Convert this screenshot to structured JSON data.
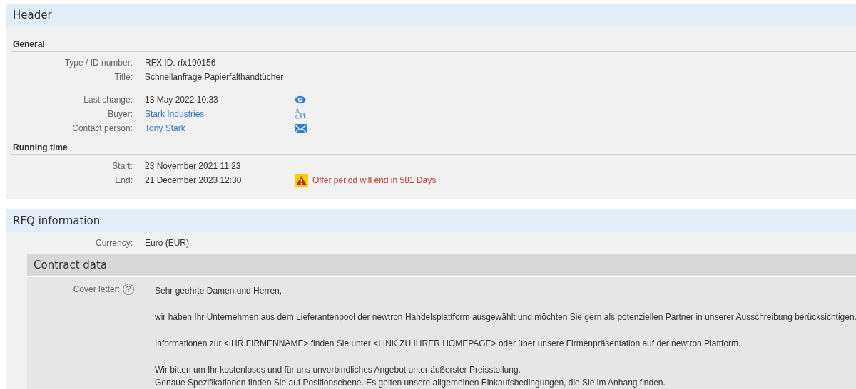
{
  "header": {
    "title": "Header",
    "sections": [
      {
        "title": "General",
        "groups": [
          [
            {
              "label": "Type / ID number:",
              "value": "RFX ID: rfx190156",
              "kind": "text"
            },
            {
              "label": "Title:",
              "value": "Schnellanfrage Papierfalthandtücher",
              "kind": "text"
            }
          ],
          [
            {
              "label": "Last change:",
              "value": "13 May 2022 10:33",
              "kind": "text",
              "action": {
                "kind": "view"
              }
            },
            {
              "label": "Buyer:",
              "value": "Stark Industries",
              "kind": "link",
              "action": {
                "kind": "letters",
                "glyphs": [
                  "A",
                  "C",
                  "B"
                ]
              }
            },
            {
              "label": "Contact person:",
              "value": "Tony Stark",
              "kind": "link",
              "action": {
                "kind": "mail"
              }
            }
          ]
        ]
      },
      {
        "title": "Running time",
        "groups": [
          [
            {
              "label": "Start:",
              "value": "23 November 2021 11:23",
              "kind": "text"
            },
            {
              "label": "End:",
              "value": "21 December 2023 12:30",
              "kind": "text",
              "warning": "Offer period will end in 581 Days"
            }
          ]
        ]
      }
    ]
  },
  "rfq": {
    "title": "RFQ information",
    "currency": {
      "label": "Currency:",
      "value": "Euro (EUR)"
    },
    "contract": {
      "title": "Contract data",
      "cover_label": "Cover letter:",
      "help": "?",
      "paragraphs": [
        [
          "Sehr geehrte Damen und Herren,"
        ],
        [
          "wir haben Ihr Unternehmen aus dem Lieferantenpool der newtron Handelsplattform ausgewählt und möchten Sie gern als potenziellen Partner in unserer Ausschreibung berücksichtigen."
        ],
        [
          "Informationen zur <IHR FIRMENNAME> finden Sie unter <LINK ZU IHRER HOMEPAGE> oder über unsere Firmenpräsentation auf der newtron Plattform."
        ],
        [
          "Wir bitten um Ihr kostenloses und für uns unverbindliches Angebot unter äußerster Preisstellung.",
          "Genaue Spezifikationen finden Sie auf Positionsebene. Es gelten unsere allgemeinen Einkaufsbedingungen, die Sie im Anhang finden."
        ]
      ]
    }
  }
}
